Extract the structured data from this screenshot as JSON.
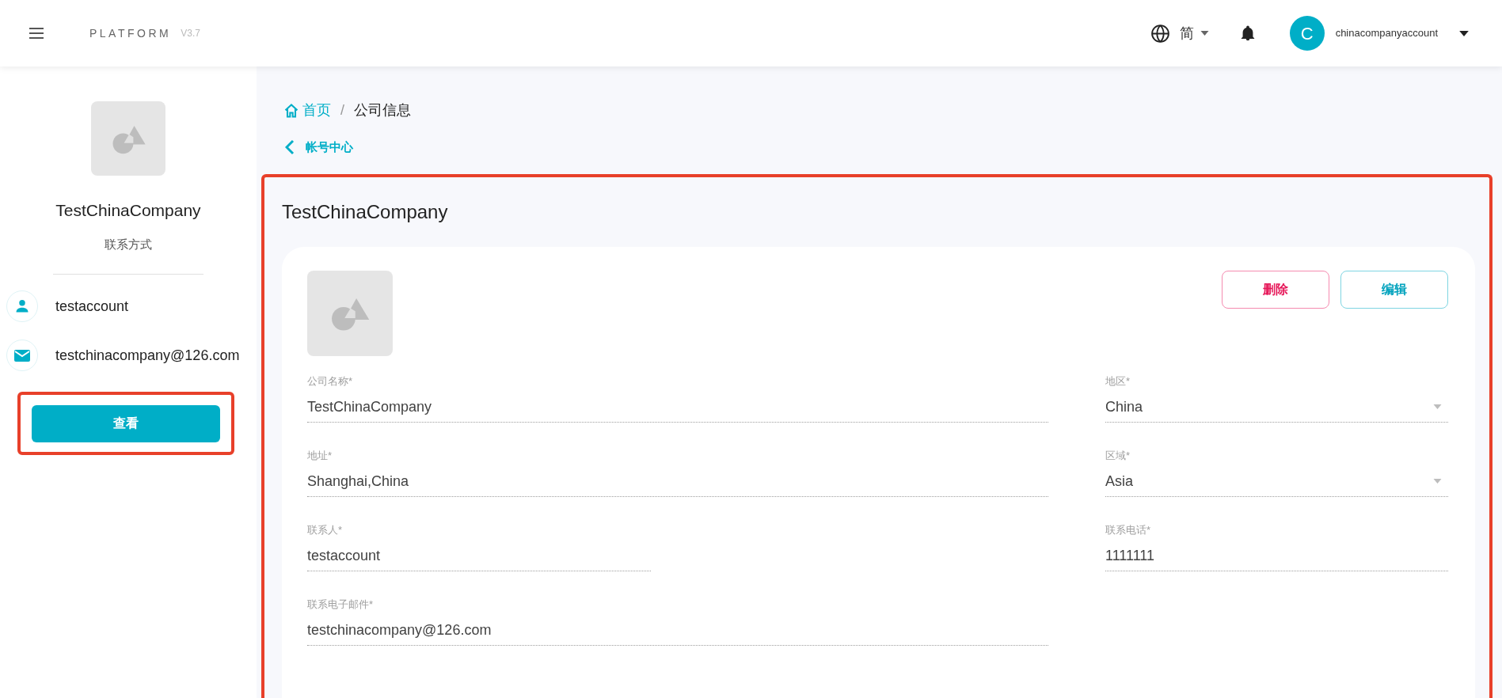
{
  "header": {
    "brand": "PLATFORM",
    "version": "V3.7",
    "language": "简",
    "avatar_letter": "C",
    "username": "chinacompanyaccount"
  },
  "sidebar": {
    "company": "TestChinaCompany",
    "subtitle": "联系方式",
    "contacts": [
      {
        "kind": "person",
        "text": "testaccount"
      },
      {
        "kind": "email",
        "text": "testchinacompany@126.com"
      }
    ],
    "button": "查看"
  },
  "breadcrumb": {
    "separator": "/",
    "items": [
      {
        "label": "首页",
        "kind": "home"
      },
      {
        "label": "公司信息",
        "kind": "current"
      }
    ]
  },
  "back_link": "帐号中心",
  "title": "TestChinaCompany",
  "actions": [
    {
      "kind": "danger",
      "label": "删除"
    },
    {
      "kind": "primary",
      "label": "编辑"
    }
  ],
  "form": {
    "rows": [
      [
        {
          "label": "公司名称*",
          "value": "TestChinaCompany",
          "kind": "text"
        },
        {
          "label": "地区*",
          "value": "China",
          "kind": "select"
        }
      ],
      [
        {
          "label": "地址*",
          "value": "Shanghai,China",
          "kind": "text"
        },
        {
          "label": "区域*",
          "value": "Asia",
          "kind": "select"
        }
      ],
      [
        {
          "label": "联系人*",
          "value": "testaccount",
          "kind": "short_text"
        },
        {
          "label": "联系电话*",
          "value": "1111111",
          "kind": "text"
        }
      ],
      [
        {
          "label": "联系电子邮件*",
          "value": "testchinacompany@126.com",
          "kind": "text"
        }
      ]
    ]
  }
}
